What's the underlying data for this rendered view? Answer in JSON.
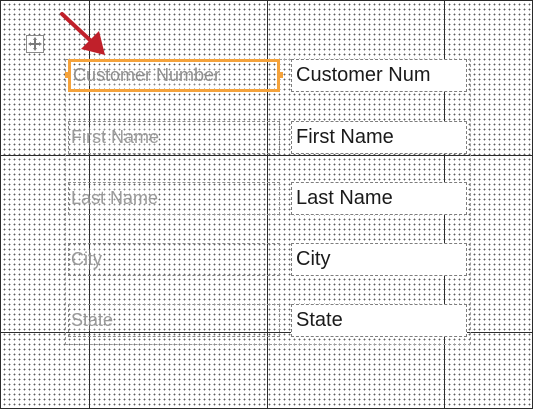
{
  "form_layout": {
    "fields": [
      {
        "label": "Customer Number",
        "textbox": "Customer Num",
        "selected": true
      },
      {
        "label": "First Name",
        "textbox": "First Name",
        "selected": false
      },
      {
        "label": "Last Name",
        "textbox": "Last Name",
        "selected": false
      },
      {
        "label": "City",
        "textbox": "City",
        "selected": false
      },
      {
        "label": "State",
        "textbox": "State",
        "selected": false
      }
    ]
  },
  "colors": {
    "selection": "#f5a33b",
    "arrow": "#c0202a"
  },
  "icons": {
    "move_handle": "move-cross-icon",
    "pointer": "red-arrow-icon"
  }
}
